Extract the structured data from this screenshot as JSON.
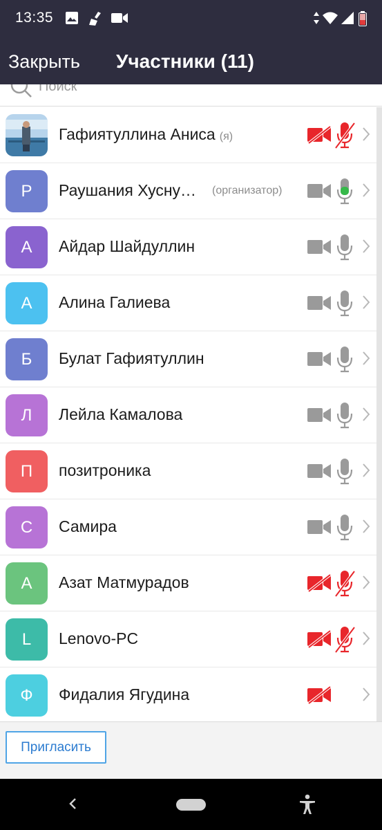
{
  "status_bar": {
    "time": "13:35",
    "left_icons": [
      "image-icon",
      "broom-icon",
      "video-icon"
    ],
    "right_icons": [
      "data-arrows-icon",
      "wifi-icon",
      "signal-icon",
      "battery-icon"
    ]
  },
  "header": {
    "close_label": "Закрыть",
    "title": "Участники (11)"
  },
  "search": {
    "placeholder": "Поиск"
  },
  "participants": [
    {
      "name": "Гафиятуллина Аниса",
      "tag": "(я)",
      "role": "",
      "avatar": "photo",
      "color": "#5b8db8",
      "camera": "off",
      "mic": "muted"
    },
    {
      "name": "Раушания Хуснy…",
      "tag": "",
      "role": "(организатор)",
      "avatar": "Р",
      "color": "#6f7fcf",
      "camera": "on",
      "mic": "speaking"
    },
    {
      "name": "Айдар Шайдуллин",
      "tag": "",
      "role": "",
      "avatar": "А",
      "color": "#8a63cf",
      "camera": "on",
      "mic": "on"
    },
    {
      "name": "Алина Галиева",
      "tag": "",
      "role": "",
      "avatar": "А",
      "color": "#4cc1f0",
      "camera": "on",
      "mic": "on"
    },
    {
      "name": "Булат Гафиятуллин",
      "tag": "",
      "role": "",
      "avatar": "Б",
      "color": "#6f7fcf",
      "camera": "on",
      "mic": "on"
    },
    {
      "name": "Лейла Камалова",
      "tag": "",
      "role": "",
      "avatar": "Л",
      "color": "#b773d6",
      "camera": "on",
      "mic": "on"
    },
    {
      "name": "позитроника",
      "tag": "",
      "role": "",
      "avatar": "П",
      "color": "#f05f61",
      "camera": "on",
      "mic": "on"
    },
    {
      "name": "Самира",
      "tag": "",
      "role": "",
      "avatar": "С",
      "color": "#b773d6",
      "camera": "on",
      "mic": "on"
    },
    {
      "name": "Азат Матмурадов",
      "tag": "",
      "role": "",
      "avatar": "А",
      "color": "#6bc47e",
      "camera": "off",
      "mic": "muted"
    },
    {
      "name": "Lenovo-PC",
      "tag": "",
      "role": "",
      "avatar": "L",
      "color": "#3dbba8",
      "camera": "off",
      "mic": "muted"
    },
    {
      "name": "Фидалия Ягудина",
      "tag": "",
      "role": "",
      "avatar": "Ф",
      "color": "#4dcfe0",
      "camera": "off",
      "mic": "none"
    }
  ],
  "bottom": {
    "invite_label": "Пригласить"
  },
  "colors": {
    "header_bg": "#2e2d3f",
    "accent": "#2b7bd0",
    "muted_red": "#e8262b",
    "speaking_green": "#36b94a",
    "icon_gray": "#9a9a9a"
  }
}
